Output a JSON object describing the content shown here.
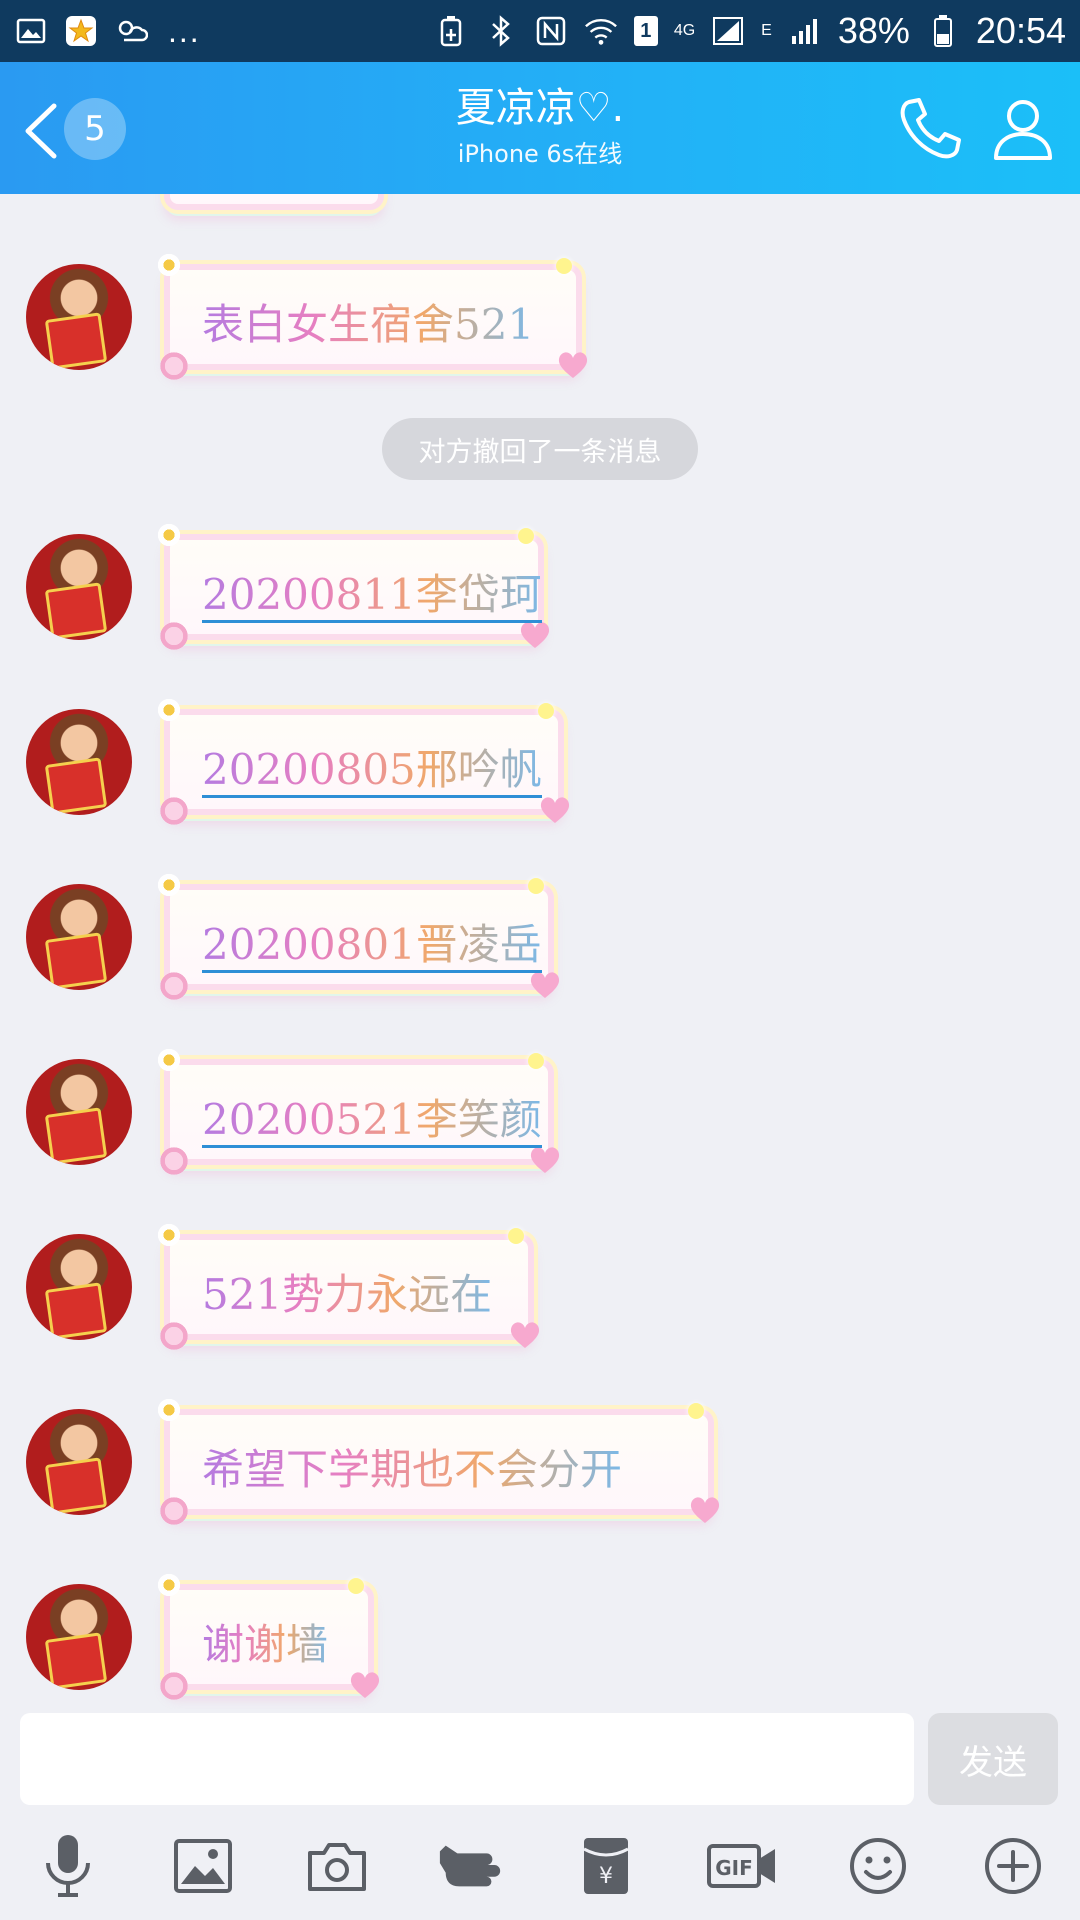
{
  "status_bar": {
    "badge": "1",
    "network": "4G",
    "edge": "E",
    "battery": "38%",
    "time": "20:54",
    "dots": "..."
  },
  "header": {
    "unread_count": "5",
    "title": "夏凉凉♡.",
    "subtitle": "iPhone 6s在线"
  },
  "messages": [
    {
      "text": "表白女生宿舍521"
    },
    {
      "text": "20200811李岱珂"
    },
    {
      "text": "20200805邢吟帆"
    },
    {
      "text": "20200801晋凌岳"
    },
    {
      "text": "20200521李笑颜"
    },
    {
      "text": "521势力永远在"
    },
    {
      "text": "希望下学期也不会分开"
    },
    {
      "text": "谢谢墙"
    }
  ],
  "system_message": "对方撤回了一条消息",
  "input": {
    "placeholder": "",
    "send_label": "发送"
  },
  "toolbar": [
    "mic-icon",
    "image-icon",
    "camera-icon",
    "poke-icon",
    "red-packet-icon",
    "gif-icon",
    "emoji-icon",
    "plus-icon"
  ],
  "colors": {
    "header_start": "#2a9af2",
    "header_end": "#1bbff8",
    "link_underline": "#2e8fd6"
  }
}
